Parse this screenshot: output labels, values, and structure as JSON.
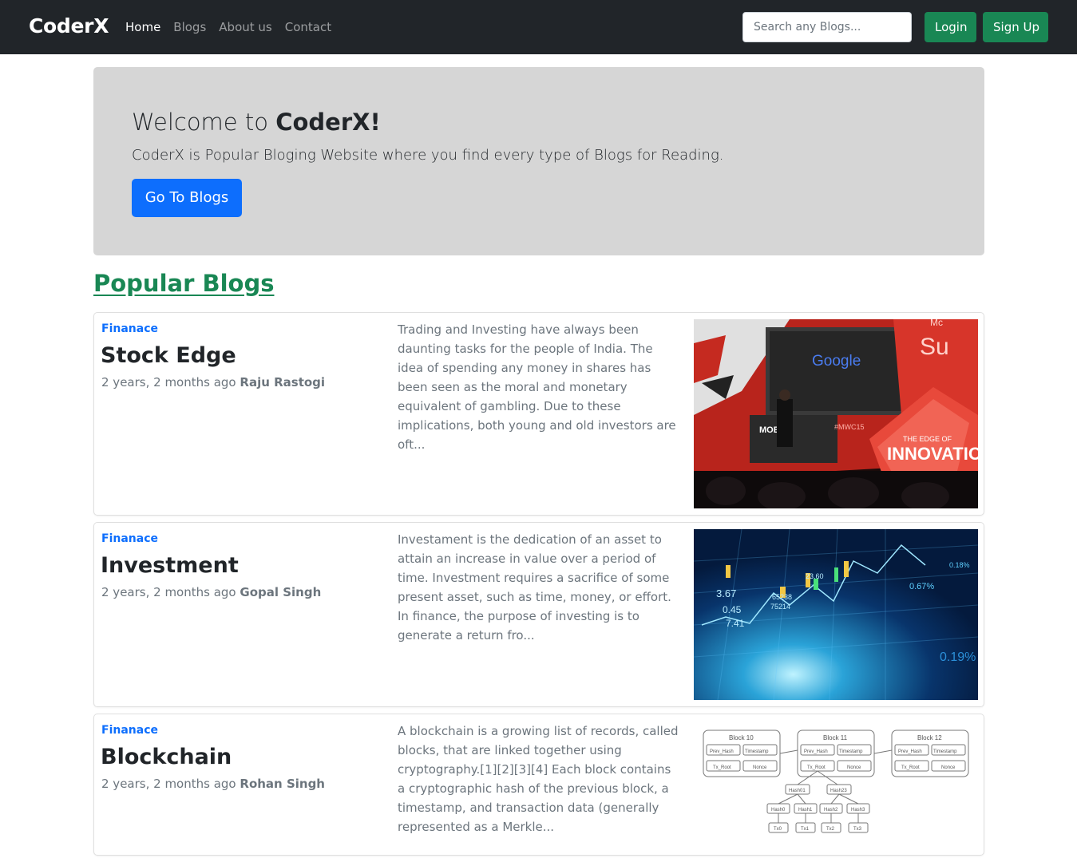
{
  "navbar": {
    "brand": "CoderX",
    "links": [
      {
        "label": "Home",
        "active": true
      },
      {
        "label": "Blogs",
        "active": false
      },
      {
        "label": "About us",
        "active": false
      },
      {
        "label": "Contact",
        "active": false
      }
    ],
    "search_placeholder": "Search any Blogs...",
    "search_value": "",
    "login_label": "Login",
    "signup_label": "Sign Up"
  },
  "hero": {
    "title_prefix": "Welcome to ",
    "title_brand": "CoderX!",
    "lead": "CoderX is Popular Bloging Website where you find every type of Blogs for Reading.",
    "button_label": "Go To Blogs"
  },
  "popular": {
    "heading": "Popular Blogs",
    "posts": [
      {
        "category": "Finanace",
        "title": "Stock Edge",
        "time": "2 years, 2 months ago",
        "author": "Raju Rastogi",
        "excerpt": "Trading and Investing have always been daunting tasks for the people of India. The idea of spending any money in shares has been seen as the moral and monetary equivalent of gambling. Due to these implications, both young and old investors are oft...",
        "image_icon": "conference-stage-image",
        "image_text": {
          "screen": "Google",
          "banner_top": "Su",
          "banner_corner": "Mc",
          "banner_small": "THE EDGE OF",
          "banner_big": "INNOVATION",
          "tag": "#MWC15",
          "sign": "MOB"
        }
      },
      {
        "category": "Finanace",
        "title": "Investment",
        "time": "2 years, 2 months ago",
        "author": "Gopal Singh",
        "excerpt": "Investament is the dedication of an asset to attain an increase in value over a period of time. Investment requires a sacrifice of some present asset, such as time, money, or effort. In finance, the purpose of investing is to generate a return fro...",
        "image_icon": "stock-chart-image",
        "image_text": {
          "n1": "3.67",
          "n2": "0.45",
          "n3": "7.41",
          "n4": "0.67%",
          "n5": "0.18%",
          "n6": "0.19%",
          "n7": "23.60",
          "n8": "65238",
          "n9": "75214"
        }
      },
      {
        "category": "Finanace",
        "title": "Blockchain",
        "time": "2 years, 2 months ago",
        "author": "Rohan Singh",
        "excerpt": "A blockchain is a growing list of records, called blocks, that are linked together using cryptography.[1][2][3][4] Each block contains a cryptographic hash of the previous block, a timestamp, and transaction data (generally represented as a Merkle...",
        "image_icon": "blockchain-diagram-image",
        "image_text": {
          "blocks": [
            "Block 10",
            "Block 11",
            "Block 12"
          ],
          "fields": [
            "Prev_Hash",
            "Timestamp",
            "Tx_Root",
            "Nonce"
          ],
          "hashes_top": [
            "Hash01",
            "Hash23"
          ],
          "hashes_mid": [
            "Hash0",
            "Hash1",
            "Hash2",
            "Hash3"
          ],
          "txs": [
            "Tx0",
            "Tx1",
            "Tx2",
            "Tx3"
          ]
        }
      }
    ]
  }
}
